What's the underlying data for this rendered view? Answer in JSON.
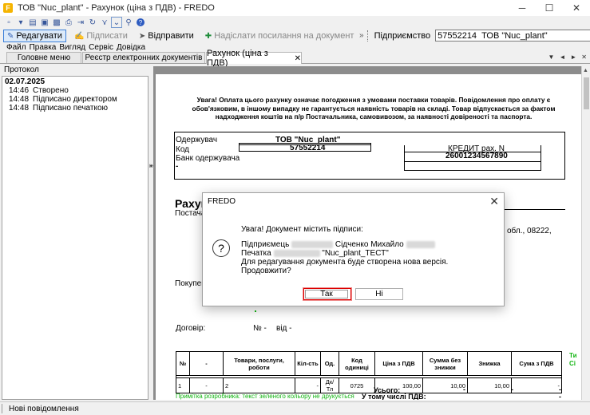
{
  "window": {
    "title": "ТОВ \"Nuc_plant\" - Рахунок (ціна з ПДВ) - FREDO",
    "logo": "F",
    "minimize": "─",
    "maximize": "☐",
    "close": "✕"
  },
  "icon_toolbar": [
    "new-doc-icon",
    "open-icon",
    "save-icon",
    "save-as-icon",
    "print-icon",
    "export-icon",
    "refresh-icon",
    "filter-icon",
    "dropdown-icon",
    "search-icon",
    "help-icon"
  ],
  "icon_glyphs": {
    "new": "▫",
    "dd": "▾",
    "open": "▤",
    "save": "▣",
    "saveas": "▩",
    "print": "⎙",
    "export": "⇥",
    "refresh": "↻",
    "filter": "⋎",
    "menu": "⌄",
    "search": "⚲",
    "help": "?"
  },
  "toolbar": {
    "edit": "Редагувати",
    "sign": "Підписати",
    "send": "Відправити",
    "send_link": "Надіслати посилання на документ",
    "enterprise_label": "Підприємство",
    "enterprise_value": "57552214  ТОВ \"Nuc_plant\"",
    "edit_glyph": "✎",
    "sign_glyph": "✍",
    "send_glyph": "➤",
    "link_glyph": "✚",
    "sep_glyph": "»"
  },
  "menu": {
    "items": [
      "Файл",
      "Правка",
      "Вигляд",
      "Сервіс",
      "Довідка"
    ]
  },
  "tabs": [
    {
      "label": "Головне меню"
    },
    {
      "label": "Реєстр електронних документів"
    },
    {
      "label": "Рахунок (ціна з ПДВ)",
      "close": "✕"
    }
  ],
  "tab_nav": {
    "down": "▼",
    "left": "◄",
    "right": "►",
    "close": "✕"
  },
  "protocol": {
    "header": "Протокол",
    "date": "02.07.2025",
    "entries": [
      {
        "time": "14:46",
        "text": "Створено"
      },
      {
        "time": "14:48",
        "text": "Підписано директором"
      },
      {
        "time": "14:48",
        "text": "Підписано печаткою"
      }
    ]
  },
  "splitter_glyph": "⇤",
  "scroll": {
    "up": "▲"
  },
  "document": {
    "warning": "Увага! Оплата цього рахунку означає погодження з умовами поставки товарів. Повідомлення про оплату є обов'язковим, в іншому випадку не гарантується наявність товарів на складі. Товар відпускається за фактом надходження коштів на п/р Постачальника, самовивозом, за наявності довіреності та паспорта.",
    "recipient_label": "Одержувач",
    "recipient_value": "ТОВ \"Nuc_plant\"",
    "code_label": "Код",
    "code_value": "57552214",
    "bank_label": "Банк одержувача",
    "dash": "-",
    "credit_label": "КРЕДИТ рах. N",
    "credit_value": "26001234567890",
    "invoice_heading": "Рахуно",
    "supplier_label": "Постача",
    "address_fragment": "обл., 08222,",
    "buyer_label": "Покупец",
    "contract_label": "Договір:",
    "contract_no": "№ -",
    "contract_from": "від -",
    "table_headers": [
      "№",
      "-",
      "Товари, послуги, роботи",
      "Кіл-сть",
      "Од.",
      "Код одиниці",
      "Ціна з ПДВ",
      "Сумма без знижки",
      "Знижка",
      "Сума з ПДВ"
    ],
    "table_row": [
      "1",
      "-",
      "2",
      "-",
      "Дк/Тл",
      "0725",
      "100,00",
      "10,00",
      "10,00",
      "-"
    ],
    "green_cut": "Ти\nСі",
    "total_label": "Усього:",
    "vat_label": "У тому числі ПДВ:",
    "green_note": "Примітка розробника: текст зеленого кольору не друкується"
  },
  "dialog": {
    "title": "FREDO",
    "close": "✕",
    "icon": "?",
    "line1": "Увага! Документ містить підписи:",
    "line2_label": "Підприємець",
    "line2_name": "Сідченко Михайло",
    "line3_label": "Печатка",
    "line3_value": "\"Nuc_plant_ТЕСТ\"",
    "line4": "Для редагування документа буде створена нова версія.",
    "line5": "Продовжити?",
    "yes": "Так",
    "no": "Ні"
  },
  "statusbar": {
    "button": "Нові повідомлення"
  }
}
